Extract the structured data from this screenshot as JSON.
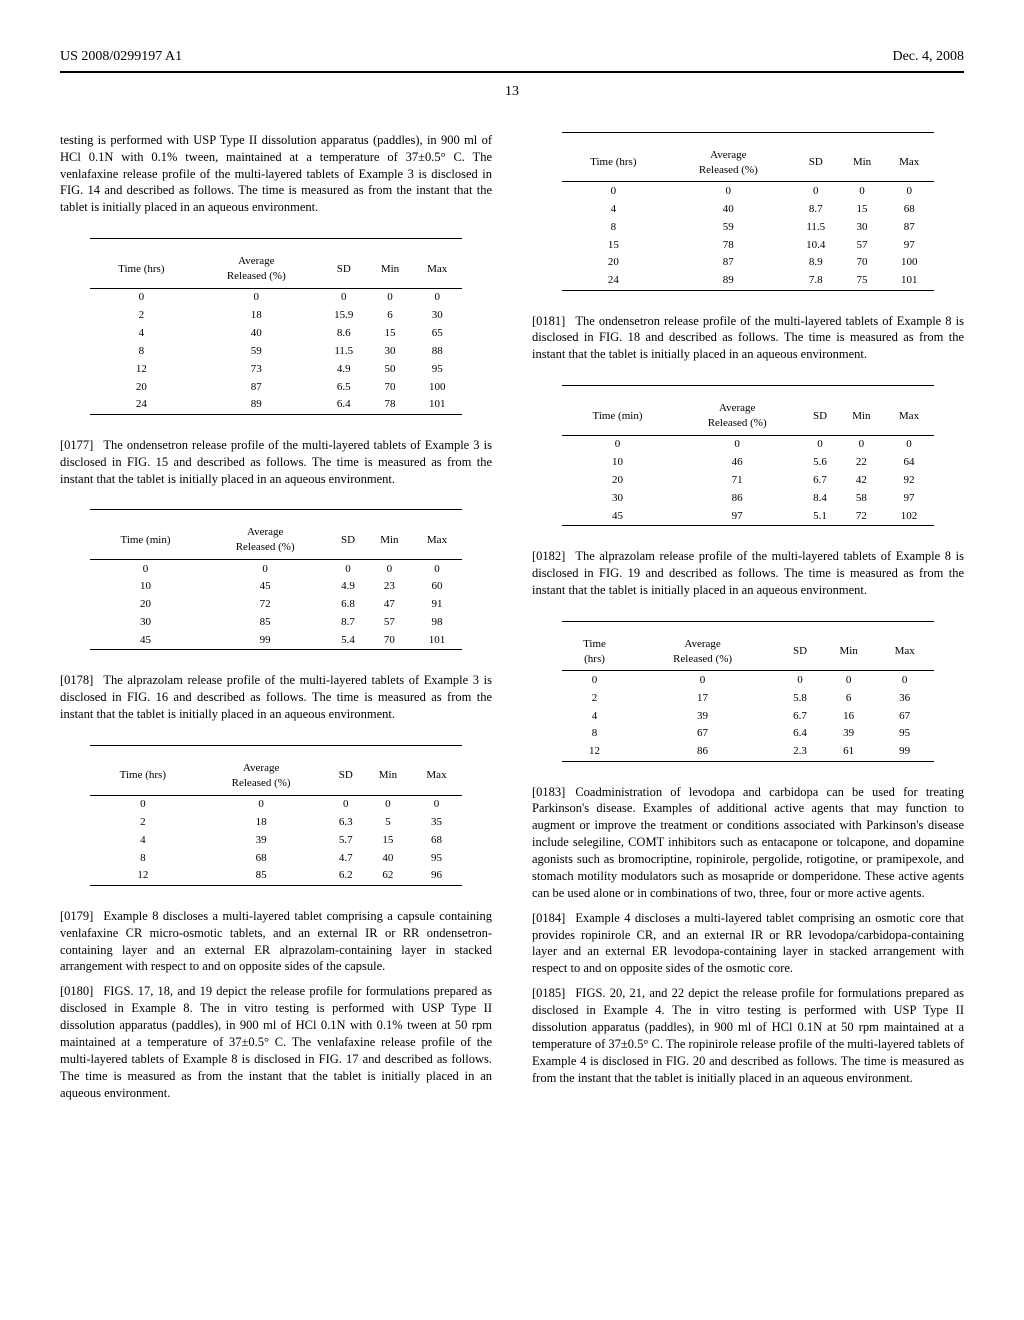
{
  "header": {
    "pub_no": "US 2008/0299197 A1",
    "date": "Dec. 4, 2008",
    "page": "13"
  },
  "intro": "testing is performed with USP Type II dissolution apparatus (paddles), in 900 ml of HCl 0.1N with 0.1% tween, maintained at a temperature of 37±0.5° C. The venlafaxine release profile of the multi-layered tablets of Example 3 is disclosed in FIG. 14 and described as follows. The time is measured as from the instant that the tablet is initially placed in an aqueous environment.",
  "tables": [
    {
      "headers": [
        "Time (hrs)",
        "Average\nReleased (%)",
        "SD",
        "Min",
        "Max"
      ],
      "rows": [
        [
          "0",
          "0",
          "0",
          "0",
          "0"
        ],
        [
          "2",
          "18",
          "15.9",
          "6",
          "30"
        ],
        [
          "4",
          "40",
          "8.6",
          "15",
          "65"
        ],
        [
          "8",
          "59",
          "11.5",
          "30",
          "88"
        ],
        [
          "12",
          "73",
          "4.9",
          "50",
          "95"
        ],
        [
          "20",
          "87",
          "6.5",
          "70",
          "100"
        ],
        [
          "24",
          "89",
          "6.4",
          "78",
          "101"
        ]
      ]
    },
    {
      "headers": [
        "Time (min)",
        "Average\nReleased (%)",
        "SD",
        "Min",
        "Max"
      ],
      "rows": [
        [
          "0",
          "0",
          "0",
          "0",
          "0"
        ],
        [
          "10",
          "45",
          "4.9",
          "23",
          "60"
        ],
        [
          "20",
          "72",
          "6.8",
          "47",
          "91"
        ],
        [
          "30",
          "85",
          "8.7",
          "57",
          "98"
        ],
        [
          "45",
          "99",
          "5.4",
          "70",
          "101"
        ]
      ]
    },
    {
      "headers": [
        "Time (hrs)",
        "Average\nReleased (%)",
        "SD",
        "Min",
        "Max"
      ],
      "rows": [
        [
          "0",
          "0",
          "0",
          "0",
          "0"
        ],
        [
          "2",
          "18",
          "6.3",
          "5",
          "35"
        ],
        [
          "4",
          "39",
          "5.7",
          "15",
          "68"
        ],
        [
          "8",
          "68",
          "4.7",
          "40",
          "95"
        ],
        [
          "12",
          "85",
          "6.2",
          "62",
          "96"
        ]
      ]
    },
    {
      "headers": [
        "Time (hrs)",
        "Average\nReleased (%)",
        "SD",
        "Min",
        "Max"
      ],
      "rows": [
        [
          "0",
          "0",
          "0",
          "0",
          "0"
        ],
        [
          "4",
          "40",
          "8.7",
          "15",
          "68"
        ],
        [
          "8",
          "59",
          "11.5",
          "30",
          "87"
        ],
        [
          "15",
          "78",
          "10.4",
          "57",
          "97"
        ],
        [
          "20",
          "87",
          "8.9",
          "70",
          "100"
        ],
        [
          "24",
          "89",
          "7.8",
          "75",
          "101"
        ]
      ]
    },
    {
      "headers": [
        "Time (min)",
        "Average\nReleased (%)",
        "SD",
        "Min",
        "Max"
      ],
      "rows": [
        [
          "0",
          "0",
          "0",
          "0",
          "0"
        ],
        [
          "10",
          "46",
          "5.6",
          "22",
          "64"
        ],
        [
          "20",
          "71",
          "6.7",
          "42",
          "92"
        ],
        [
          "30",
          "86",
          "8.4",
          "58",
          "97"
        ],
        [
          "45",
          "97",
          "5.1",
          "72",
          "102"
        ]
      ]
    },
    {
      "headers": [
        "Time\n(hrs)",
        "Average\nReleased (%)",
        "SD",
        "Min",
        "Max"
      ],
      "rows": [
        [
          "0",
          "0",
          "0",
          "0",
          "0"
        ],
        [
          "2",
          "17",
          "5.8",
          "6",
          "36"
        ],
        [
          "4",
          "39",
          "6.7",
          "16",
          "67"
        ],
        [
          "8",
          "67",
          "6.4",
          "39",
          "95"
        ],
        [
          "12",
          "86",
          "2.3",
          "61",
          "99"
        ]
      ]
    }
  ],
  "paragraphs": {
    "0177": {
      "tag": "[0177]",
      "text": "The ondensetron release profile of the multi-layered tablets of Example 3 is disclosed in FIG. 15 and described as follows. The time is measured as from the instant that the tablet is initially placed in an aqueous environment."
    },
    "0178": {
      "tag": "[0178]",
      "text": "The alprazolam release profile of the multi-layered tablets of Example 3 is disclosed in FIG. 16 and described as follows. The time is measured as from the instant that the tablet is initially placed in an aqueous environment."
    },
    "0179": {
      "tag": "[0179]",
      "text": "Example 8 discloses a multi-layered tablet comprising a capsule containing venlafaxine CR micro-osmotic tablets, and an external IR or RR ondensetron-containing layer and an external ER alprazolam-containing layer in stacked arrangement with respect to and on opposite sides of the capsule."
    },
    "0180": {
      "tag": "[0180]",
      "text": "FIGS. 17, 18, and 19 depict the release profile for formulations prepared as disclosed in Example 8. The in vitro testing is performed with USP Type II dissolution apparatus (paddles), in 900 ml of HCl 0.1N with 0.1% tween at 50 rpm maintained at a temperature of 37±0.5° C. The venlafaxine release profile of the multi-layered tablets of Example 8 is disclosed in FIG. 17 and described as follows. The time is measured as from the instant that the tablet is initially placed in an aqueous environment."
    },
    "0181": {
      "tag": "[0181]",
      "text": "The ondensetron release profile of the multi-layered tablets of Example 8 is disclosed in FIG. 18 and described as follows. The time is measured as from the instant that the tablet is initially placed in an aqueous environment."
    },
    "0182": {
      "tag": "[0182]",
      "text": "The alprazolam release profile of the multi-layered tablets of Example 8 is disclosed in FIG. 19 and described as follows. The time is measured as from the instant that the tablet is initially placed in an aqueous environment."
    },
    "0183": {
      "tag": "[0183]",
      "text": "Coadministration of levodopa and carbidopa can be used for treating Parkinson's disease. Examples of additional active agents that may function to augment or improve the treatment or conditions associated with Parkinson's disease include selegiline, COMT inhibitors such as entacapone or tolcapone, and dopamine agonists such as bromocriptine, ropinirole, pergolide, rotigotine, or pramipexole, and stomach motility modulators such as mosapride or domperidone. These active agents can be used alone or in combinations of two, three, four or more active agents."
    },
    "0184": {
      "tag": "[0184]",
      "text": "Example 4 discloses a multi-layered tablet comprising an osmotic core that provides ropinirole CR, and an external IR or RR levodopa/carbidopa-containing layer and an external ER levodopa-containing layer in stacked arrangement with respect to and on opposite sides of the osmotic core."
    },
    "0185": {
      "tag": "[0185]",
      "text": "FIGS. 20, 21, and 22 depict the release profile for formulations prepared as disclosed in Example 4. The in vitro testing is performed with USP Type II dissolution apparatus (paddles), in 900 ml of HCl 0.1N at 50 rpm maintained at a temperature of 37±0.5° C. The ropinirole release profile of the multi-layered tablets of Example 4 is disclosed in FIG. 20 and described as follows. The time is measured as from the instant that the tablet is initially placed in an aqueous environment."
    }
  }
}
